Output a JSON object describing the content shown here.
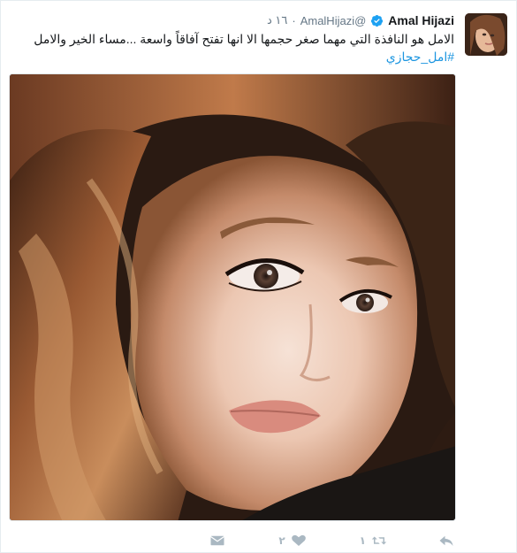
{
  "tweet": {
    "author": {
      "full_name": "Amal Hijazi",
      "handle": "@AmalHijazi",
      "verified": true
    },
    "separator": "·",
    "time": "١٦ د",
    "text": "الامل هو النافذة التي مهما صغر حجمها الا انها تفتح آفاقاً واسعة ...مساء الخير والامل",
    "hashtag": "#امل_حجازي",
    "actions": {
      "reply_icon": "reply-icon",
      "retweet_icon": "retweet-icon",
      "retweet_count": "١",
      "like_icon": "heart-icon",
      "like_count": "٢",
      "dm_icon": "envelope-icon"
    },
    "colors": {
      "link": "#1b95e0",
      "muted": "#657786",
      "action": "#aab8c2",
      "verified": "#1da1f2"
    }
  }
}
